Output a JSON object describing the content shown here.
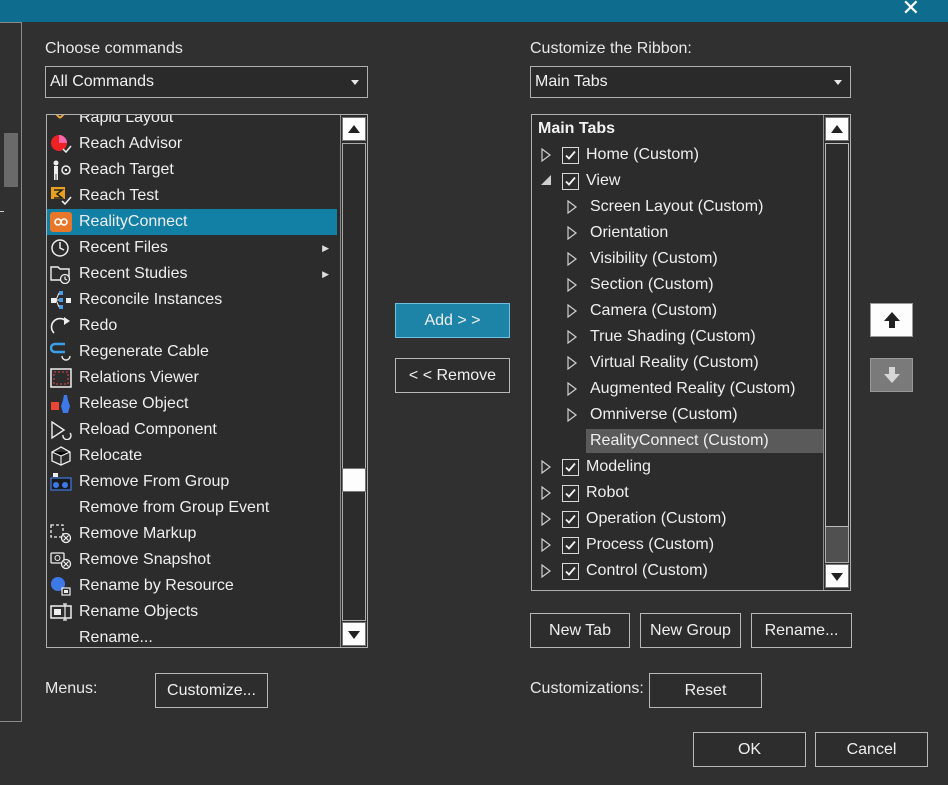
{
  "window": {
    "close_label": "✕"
  },
  "left": {
    "title": "Choose commands",
    "dropdown_value": "All Commands",
    "commands": [
      {
        "label": "Rapid Layout",
        "icon": "rapid-layout-icon",
        "submenu": false,
        "selected": false
      },
      {
        "label": "Reach Advisor",
        "icon": "reach-advisor-icon",
        "submenu": false,
        "selected": false
      },
      {
        "label": "Reach Target",
        "icon": "reach-target-icon",
        "submenu": false,
        "selected": false
      },
      {
        "label": "Reach Test",
        "icon": "reach-test-icon",
        "submenu": false,
        "selected": false
      },
      {
        "label": "RealityConnect",
        "icon": "realityconnect-icon",
        "submenu": false,
        "selected": true
      },
      {
        "label": "Recent Files",
        "icon": "recent-files-icon",
        "submenu": true,
        "selected": false
      },
      {
        "label": "Recent Studies",
        "icon": "recent-studies-icon",
        "submenu": true,
        "selected": false
      },
      {
        "label": "Reconcile Instances",
        "icon": "reconcile-instances-icon",
        "submenu": false,
        "selected": false
      },
      {
        "label": "Redo",
        "icon": "redo-icon",
        "submenu": false,
        "selected": false
      },
      {
        "label": "Regenerate Cable",
        "icon": "regenerate-cable-icon",
        "submenu": false,
        "selected": false
      },
      {
        "label": "Relations Viewer",
        "icon": "relations-viewer-icon",
        "submenu": false,
        "selected": false
      },
      {
        "label": "Release Object",
        "icon": "release-object-icon",
        "submenu": false,
        "selected": false
      },
      {
        "label": "Reload Component",
        "icon": "reload-component-icon",
        "submenu": false,
        "selected": false
      },
      {
        "label": "Relocate",
        "icon": "relocate-icon",
        "submenu": false,
        "selected": false
      },
      {
        "label": "Remove From Group",
        "icon": "remove-from-group-icon",
        "submenu": false,
        "selected": false
      },
      {
        "label": "Remove from Group Event",
        "icon": "",
        "submenu": false,
        "selected": false
      },
      {
        "label": "Remove Markup",
        "icon": "remove-markup-icon",
        "submenu": false,
        "selected": false
      },
      {
        "label": "Remove Snapshot",
        "icon": "remove-snapshot-icon",
        "submenu": false,
        "selected": false
      },
      {
        "label": "Rename by Resource",
        "icon": "rename-by-resource-icon",
        "submenu": false,
        "selected": false
      },
      {
        "label": "Rename Objects",
        "icon": "rename-objects-icon",
        "submenu": false,
        "selected": false
      },
      {
        "label": "Rename...",
        "icon": "",
        "submenu": false,
        "selected": false
      }
    ],
    "menus_label": "Menus:",
    "customize_button": "Customize..."
  },
  "middle": {
    "add_button": "Add > >",
    "remove_button": "< < Remove"
  },
  "right": {
    "title": "Customize the Ribbon:",
    "dropdown_value": "Main Tabs",
    "tree_header": "Main Tabs",
    "tree": [
      {
        "label": "Home (Custom)",
        "level": 0,
        "expanded": false,
        "checkbox": true,
        "checked": true,
        "highlight": false
      },
      {
        "label": "View",
        "level": 0,
        "expanded": true,
        "checkbox": true,
        "checked": true,
        "highlight": false
      },
      {
        "label": "Screen Layout (Custom)",
        "level": 1,
        "expanded": false,
        "checkbox": false,
        "highlight": false
      },
      {
        "label": "Orientation",
        "level": 1,
        "expanded": false,
        "checkbox": false,
        "highlight": false
      },
      {
        "label": "Visibility (Custom)",
        "level": 1,
        "expanded": false,
        "checkbox": false,
        "highlight": false
      },
      {
        "label": "Section (Custom)",
        "level": 1,
        "expanded": false,
        "checkbox": false,
        "highlight": false
      },
      {
        "label": "Camera (Custom)",
        "level": 1,
        "expanded": false,
        "checkbox": false,
        "highlight": false
      },
      {
        "label": "True Shading (Custom)",
        "level": 1,
        "expanded": false,
        "checkbox": false,
        "highlight": false
      },
      {
        "label": "Virtual Reality (Custom)",
        "level": 1,
        "expanded": false,
        "checkbox": false,
        "highlight": false
      },
      {
        "label": "Augmented Reality (Custom)",
        "level": 1,
        "expanded": false,
        "checkbox": false,
        "highlight": false
      },
      {
        "label": "Omniverse (Custom)",
        "level": 1,
        "expanded": false,
        "checkbox": false,
        "highlight": false
      },
      {
        "label": "RealityConnect (Custom)",
        "level": 1,
        "expanded": null,
        "checkbox": false,
        "highlight": true
      },
      {
        "label": "Modeling",
        "level": 0,
        "expanded": false,
        "checkbox": true,
        "checked": true,
        "highlight": false
      },
      {
        "label": "Robot",
        "level": 0,
        "expanded": false,
        "checkbox": true,
        "checked": true,
        "highlight": false
      },
      {
        "label": "Operation (Custom)",
        "level": 0,
        "expanded": false,
        "checkbox": true,
        "checked": true,
        "highlight": false
      },
      {
        "label": "Process (Custom)",
        "level": 0,
        "expanded": false,
        "checkbox": true,
        "checked": true,
        "highlight": false
      },
      {
        "label": "Control (Custom)",
        "level": 0,
        "expanded": false,
        "checkbox": true,
        "checked": true,
        "highlight": false
      }
    ],
    "new_tab_button": "New Tab",
    "new_group_button": "New Group",
    "rename_button": "Rename...",
    "customizations_label": "Customizations:",
    "reset_button": "Reset"
  },
  "footer": {
    "ok_button": "OK",
    "cancel_button": "Cancel"
  },
  "colors": {
    "accent": "#127fa4",
    "titlebar": "#0e6d8e",
    "background": "#303030"
  }
}
